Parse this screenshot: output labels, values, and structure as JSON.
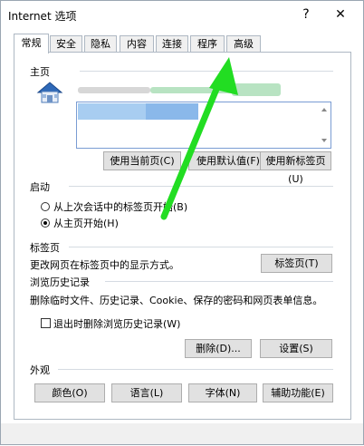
{
  "window": {
    "title": "Internet 选项",
    "help_glyph": "?",
    "close_glyph": "✕"
  },
  "tabs": [
    "常规",
    "安全",
    "隐私",
    "内容",
    "连接",
    "程序",
    "高级"
  ],
  "homepage": {
    "heading": "主页",
    "buttons": {
      "use_current": "使用当前页(C)",
      "use_default": "使用默认值(F)",
      "use_new_tab": "使用新标签页(U)"
    }
  },
  "startup": {
    "heading": "启动",
    "option_last_session": "从上次会话中的标签页开始(B)",
    "option_homepage": "从主页开始(H)",
    "selected": "option_homepage"
  },
  "tabs_section": {
    "heading": "标签页",
    "description": "更改网页在标签页中的显示方式。",
    "button": "标签页(T)"
  },
  "history": {
    "heading": "浏览历史记录",
    "description": "删除临时文件、历史记录、Cookie、保存的密码和网页表单信息。",
    "checkbox_label": "退出时删除浏览历史记录(W)",
    "checkbox_checked": false,
    "delete_button": "删除(D)...",
    "settings_button": "设置(S)"
  },
  "appearance": {
    "heading": "外观",
    "colors_button": "颜色(O)",
    "languages_button": "语言(L)",
    "fonts_button": "字体(N)",
    "accessibility_button": "辅助功能(E)"
  },
  "colors": {
    "arrow": "#22dd22",
    "accent": "#0078d7"
  }
}
